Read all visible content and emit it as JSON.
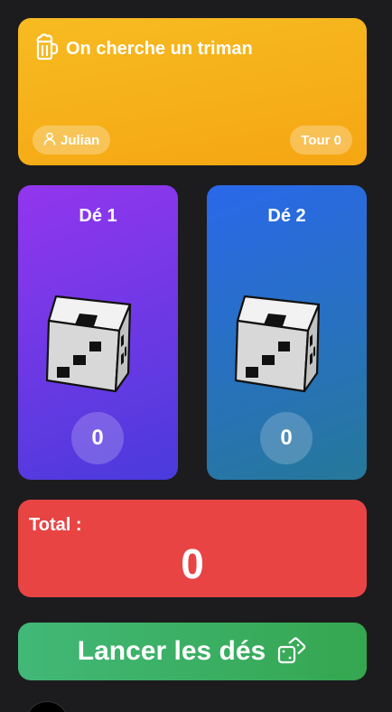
{
  "header": {
    "title": "On cherche un triman",
    "icon": "beer-mug-icon",
    "player_name": "Julian",
    "player_icon": "user-icon",
    "turn_label": "Tour 0"
  },
  "dice": [
    {
      "title": "Dé 1",
      "value": "0"
    },
    {
      "title": "Dé 2",
      "value": "0"
    }
  ],
  "total": {
    "label": "Total :",
    "value": "0"
  },
  "roll_button": {
    "label": "Lancer les dés",
    "icon": "dice-icon"
  },
  "colors": {
    "header": "#f5ae17",
    "die1": "#7b38e8",
    "die2": "#2a6fd0",
    "total": "#e84444",
    "roll": "#3cb065",
    "background": "#1c1c1e"
  }
}
